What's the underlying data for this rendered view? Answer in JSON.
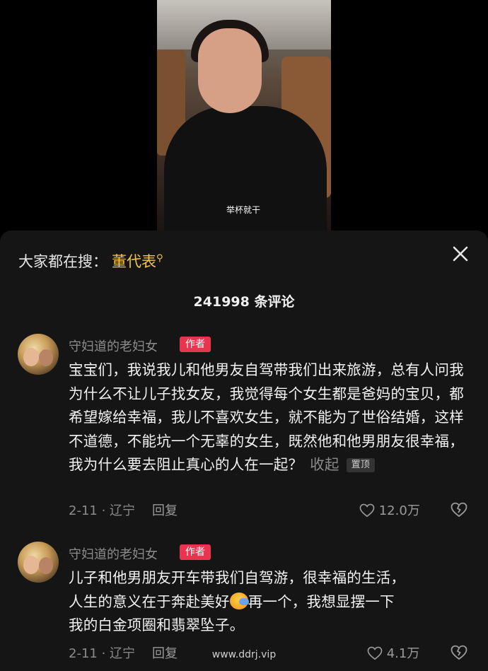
{
  "video": {
    "caption": "举杯就干"
  },
  "panel": {
    "search_prefix": "大家都在搜：",
    "search_term": "董代表",
    "comment_count": "241998 条评论"
  },
  "comments": [
    {
      "author": "守妇道的老妇女",
      "badge": "作者",
      "text": "宝宝们，我说我儿和他男友自驾带我们出来旅游，总有人问我为什么不让儿子找女友，我觉得每个女生都是爸妈的宝贝，都希望嫁给幸福，我儿不喜欢女生，就不能为了世俗结婚，这样不道德，不能坑一个无辜的女生，既然他和他男朋友很幸福，我为什么要去阻止真心的人在一起？",
      "collapse_label": "收起",
      "pin_label": "置顶",
      "date_location": "2-11 · 辽宁",
      "reply_label": "回复",
      "likes": "12.0万"
    },
    {
      "author": "守妇道的老妇女",
      "badge": "作者",
      "text_lines": [
        "儿子和他男朋友开车带我们自驾游，很幸福的生活，",
        "人生的意义在于奔赴美好",
        "再一个，我想显摆一下",
        "我的白金项圈和翡翠坠子。"
      ],
      "date_location": "2-11 · 辽宁",
      "reply_label": "回复",
      "likes": "4.1万"
    }
  ],
  "watermark": "www.ddrj.vip",
  "colors": {
    "badge": "#e8344e",
    "search_highlight": "#f3c64a",
    "sheet_bg": "#151515"
  },
  "icons": {
    "search": "search-icon",
    "close": "close-icon",
    "like": "heart-icon",
    "dislike": "broken-heart-icon",
    "emoji": "hug-emoji-icon"
  }
}
